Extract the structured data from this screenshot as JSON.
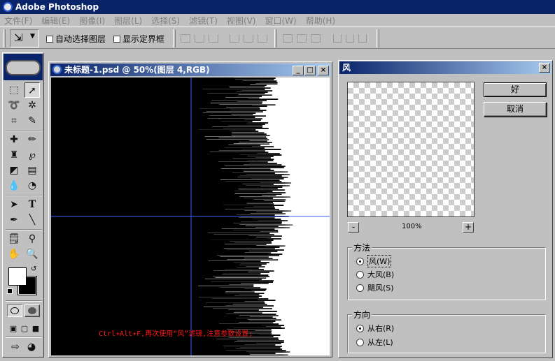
{
  "app": {
    "title": "Adobe Photoshop"
  },
  "menu": [
    "文件(F)",
    "编辑(E)",
    "图像(I)",
    "图层(L)",
    "选择(S)",
    "滤镜(T)",
    "视图(V)",
    "窗口(W)",
    "帮助(H)"
  ],
  "options": {
    "auto_select_layer": "自动选择图层",
    "show_bounding_box": "显示定界框"
  },
  "document": {
    "title": "未标题-1.psd @ 50%(图层 4,RGB)",
    "caption": "Ctrl+Alt+F,再次使用“风”滤镜,注意参数设置;"
  },
  "dialog": {
    "title": "风",
    "ok": "好",
    "cancel": "取消",
    "zoom": "100%",
    "zoom_minus": "-",
    "zoom_plus": "+",
    "method_label": "方法",
    "methods": [
      "风(W)",
      "大风(B)",
      "飓风(S)"
    ],
    "direction_label": "方向",
    "directions": [
      "从右(R)",
      "从左(L)"
    ]
  },
  "colors": {
    "title_bar": "#0a246a",
    "guide": "#3a5cff",
    "caption": "#ff1a1a"
  }
}
